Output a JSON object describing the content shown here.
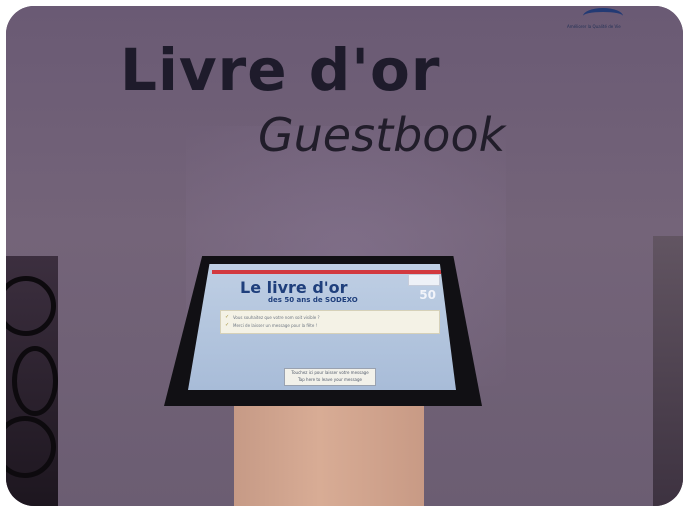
{
  "sign": {
    "title_fr": "Livre d'or",
    "title_en": "Guestbook"
  },
  "brand": {
    "tagline": "Améliorer la Qualité de Vie"
  },
  "kiosk": {
    "screen_title": "Le livre d'or",
    "screen_subtitle": "des 50 ans de SODEXO",
    "anniversary_badge": "50",
    "notes": [
      "Vous souhaitez que votre nom soit visible ?",
      "Merci de laisser un message pour la fête !"
    ],
    "note_icon": "check-icon",
    "touch_button_lines": [
      "Touchez ici pour laisser votre message",
      "Tap here to leave your message"
    ]
  },
  "colors": {
    "sign_text": "#1e1b2b",
    "screen_title": "#1f3f7c",
    "screen_accent": "#d2393f",
    "stand": "#d8ac95",
    "backdrop": "#746479"
  }
}
